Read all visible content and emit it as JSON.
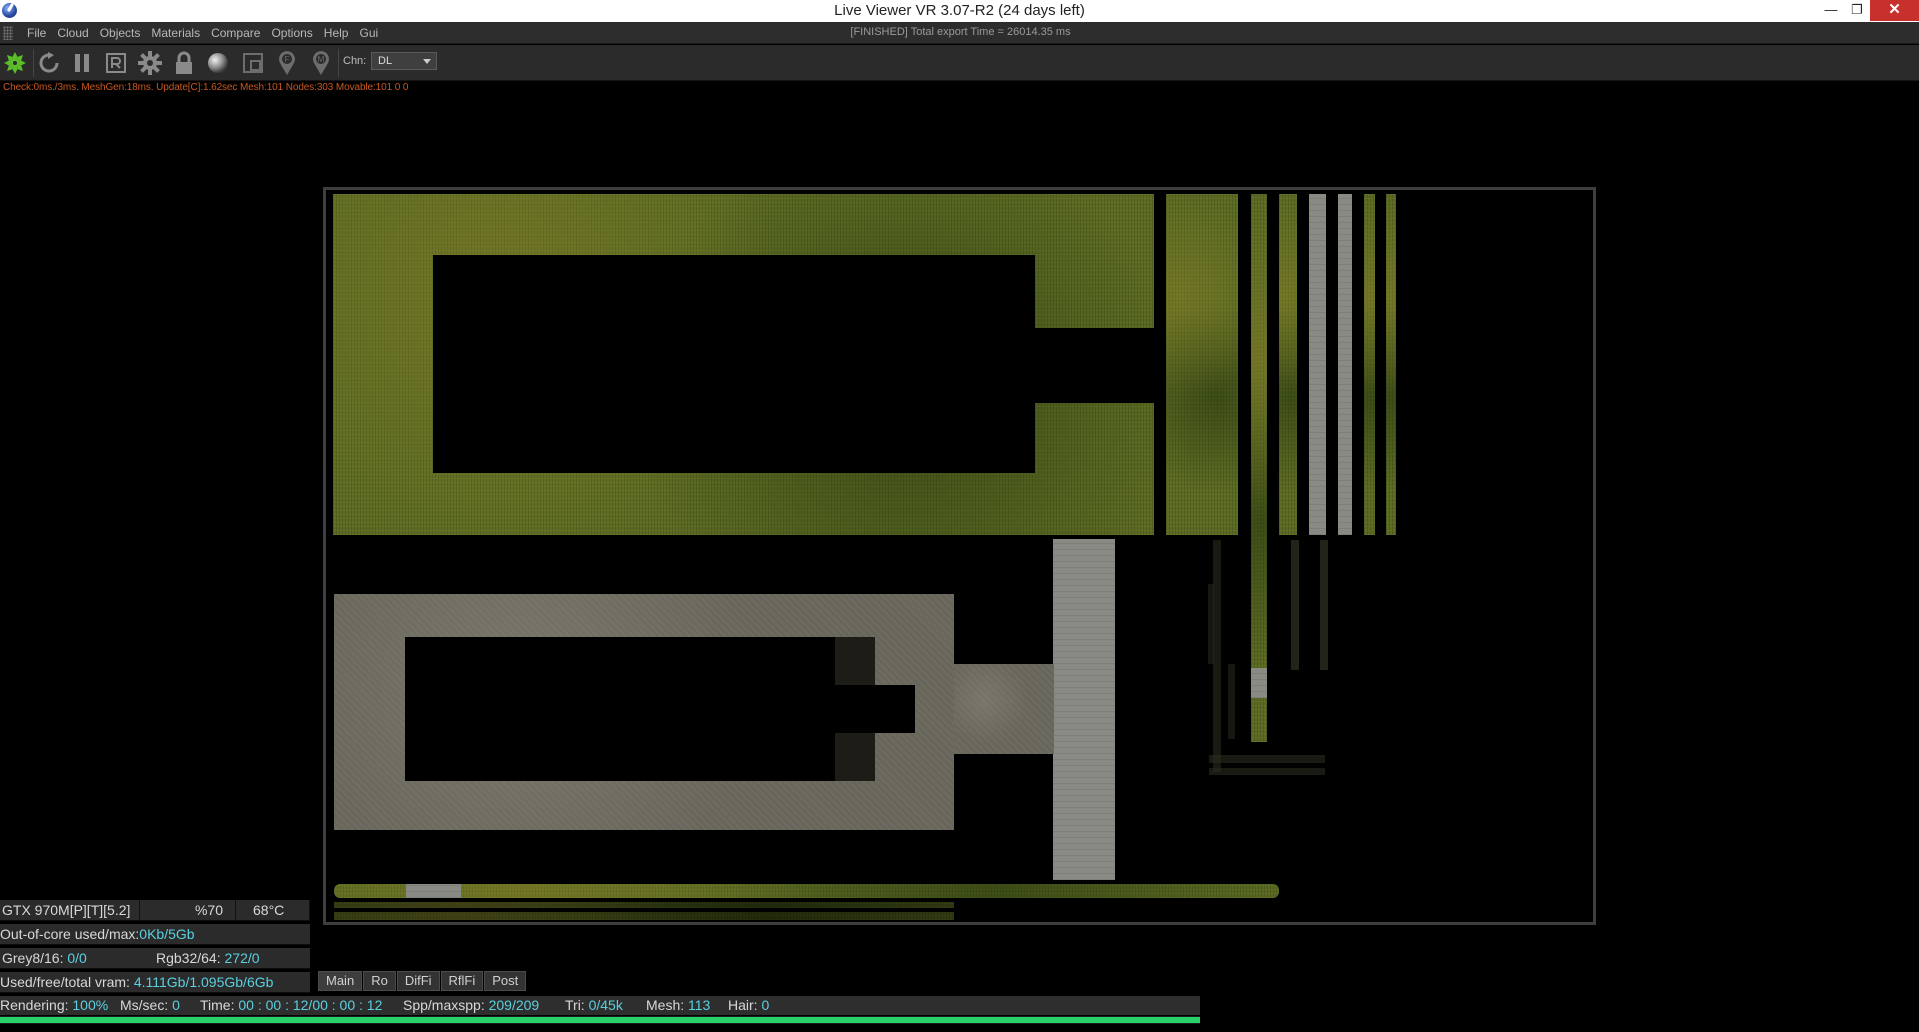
{
  "window": {
    "title": "Live Viewer VR 3.07-R2 (24 days left)",
    "status": "[FINISHED] Total export Time = 26014.35 ms",
    "min_glyph": "—",
    "max_glyph": "❐",
    "close_glyph": "✕"
  },
  "menu": [
    "File",
    "Cloud",
    "Objects",
    "Materials",
    "Compare",
    "Options",
    "Help",
    "Gui"
  ],
  "toolbar": {
    "channel_label": "Chn:",
    "channel_value": "DL",
    "icons": [
      "render-start-icon",
      "restart-icon",
      "pause-icon",
      "region-icon",
      "settings-icon",
      "lock-icon",
      "material-sphere-icon",
      "focus-frame-icon",
      "focus-picker-icon",
      "material-picker-icon"
    ]
  },
  "info_line": "Check:0ms./3ms. MeshGen:18ms. Update[C]:1.62sec Mesh:101 Nodes:303 Movable:101  0 0",
  "stats": {
    "gpu_name": "GTX 970M[P][T][5.2]",
    "gpu_load": "%70",
    "gpu_temp": "68°C",
    "ooc_label": "Out-of-core used/max:",
    "ooc_value": "0Kb/5Gb",
    "grey_label": "Grey8/16: ",
    "grey_value": "0/0",
    "rgb_label": "Rgb32/64: ",
    "rgb_value": "272/0",
    "vram_label": "Used/free/total vram: ",
    "vram_value": "4.111Gb/1.095Gb/6Gb"
  },
  "tabs": [
    "Main",
    "Ro",
    "DifFi",
    "RflFi",
    "Post"
  ],
  "render": {
    "rendering_label": "Rendering: ",
    "rendering_value": "100%",
    "ms_label": "Ms/sec: ",
    "ms_value": "0",
    "time_label": "Time: ",
    "time_value": "00 : 00 : 12/00 : 00 : 12",
    "spp_label": "Spp/maxspp: ",
    "spp_value": "209/209",
    "tri_label": "Tri: ",
    "tri_value": "0/45k",
    "mesh_label": "Mesh: ",
    "mesh_value": "113",
    "hair_label": "Hair: ",
    "hair_value": "0",
    "progress_fraction": 1.0
  },
  "colors": {
    "accent_green": "#28d26a",
    "stat_value": "#5ad0e0",
    "info_orange": "#c8581e"
  }
}
